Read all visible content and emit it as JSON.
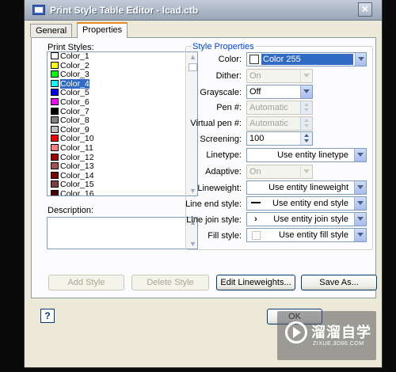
{
  "window": {
    "title": "Print Style Table Editor - lcad.ctb",
    "close_label": "×"
  },
  "tabs": [
    {
      "label": "General",
      "active": false
    },
    {
      "label": "Properties",
      "active": true
    }
  ],
  "print_styles": {
    "label": "Print Styles:",
    "selected_index": 3,
    "items": [
      {
        "label": "Color_1",
        "color": "#ff0000"
      },
      {
        "label": "Color_2",
        "color": "#ffff00"
      },
      {
        "label": "Color_3",
        "color": "#00ff00"
      },
      {
        "label": "Color_4",
        "color": "#00ffff"
      },
      {
        "label": "Color_5",
        "color": "#0000ff"
      },
      {
        "label": "Color_6",
        "color": "#ff00ff"
      },
      {
        "label": "Color_7",
        "color": "#000000"
      },
      {
        "label": "Color_8",
        "color": "#808080"
      },
      {
        "label": "Color_9",
        "color": "#c0c0c0"
      },
      {
        "label": "Color_10",
        "color": "#ff0000"
      },
      {
        "label": "Color_11",
        "color": "#ff7f7f"
      },
      {
        "label": "Color_12",
        "color": "#a50000"
      },
      {
        "label": "Color_13",
        "color": "#a55252"
      },
      {
        "label": "Color_14",
        "color": "#7f0000"
      },
      {
        "label": "Color_15",
        "color": "#7f3f3f"
      },
      {
        "label": "Color_16",
        "color": "#4c0000"
      }
    ]
  },
  "description": {
    "label": "Description:",
    "value": ""
  },
  "style_properties": {
    "title": "Style Properties",
    "color": {
      "label": "Color:",
      "value": "Color 255",
      "swatch": "#ffffff"
    },
    "dither": {
      "label": "Dither:",
      "value": "On"
    },
    "grayscale": {
      "label": "Grayscale:",
      "value": "Off"
    },
    "pen": {
      "label": "Pen #:",
      "value": "Automatic"
    },
    "virtual_pen": {
      "label": "Virtual pen #:",
      "value": "Automatic"
    },
    "screening": {
      "label": "Screening:",
      "value": "100"
    },
    "linetype": {
      "label": "Linetype:",
      "value": "Use entity linetype"
    },
    "adaptive": {
      "label": "Adaptive:",
      "value": "On"
    },
    "lineweight": {
      "label": "Lineweight:",
      "value": "Use entity lineweight"
    },
    "line_end": {
      "label": "Line end style:",
      "value": "Use entity end style"
    },
    "line_join": {
      "label": "Line join style:",
      "value": "Use entity join style"
    },
    "fill": {
      "label": "Fill style:",
      "value": "Use entity fill style"
    }
  },
  "buttons": {
    "add_style": "Add Style",
    "delete_style": "Delete Style",
    "edit_lineweights": "Edit Lineweights...",
    "save_as": "Save As...",
    "ok": "OK",
    "help": "?"
  },
  "watermark": {
    "brand": "溜溜自学",
    "url": "ZIXUE.3D66.COM"
  }
}
